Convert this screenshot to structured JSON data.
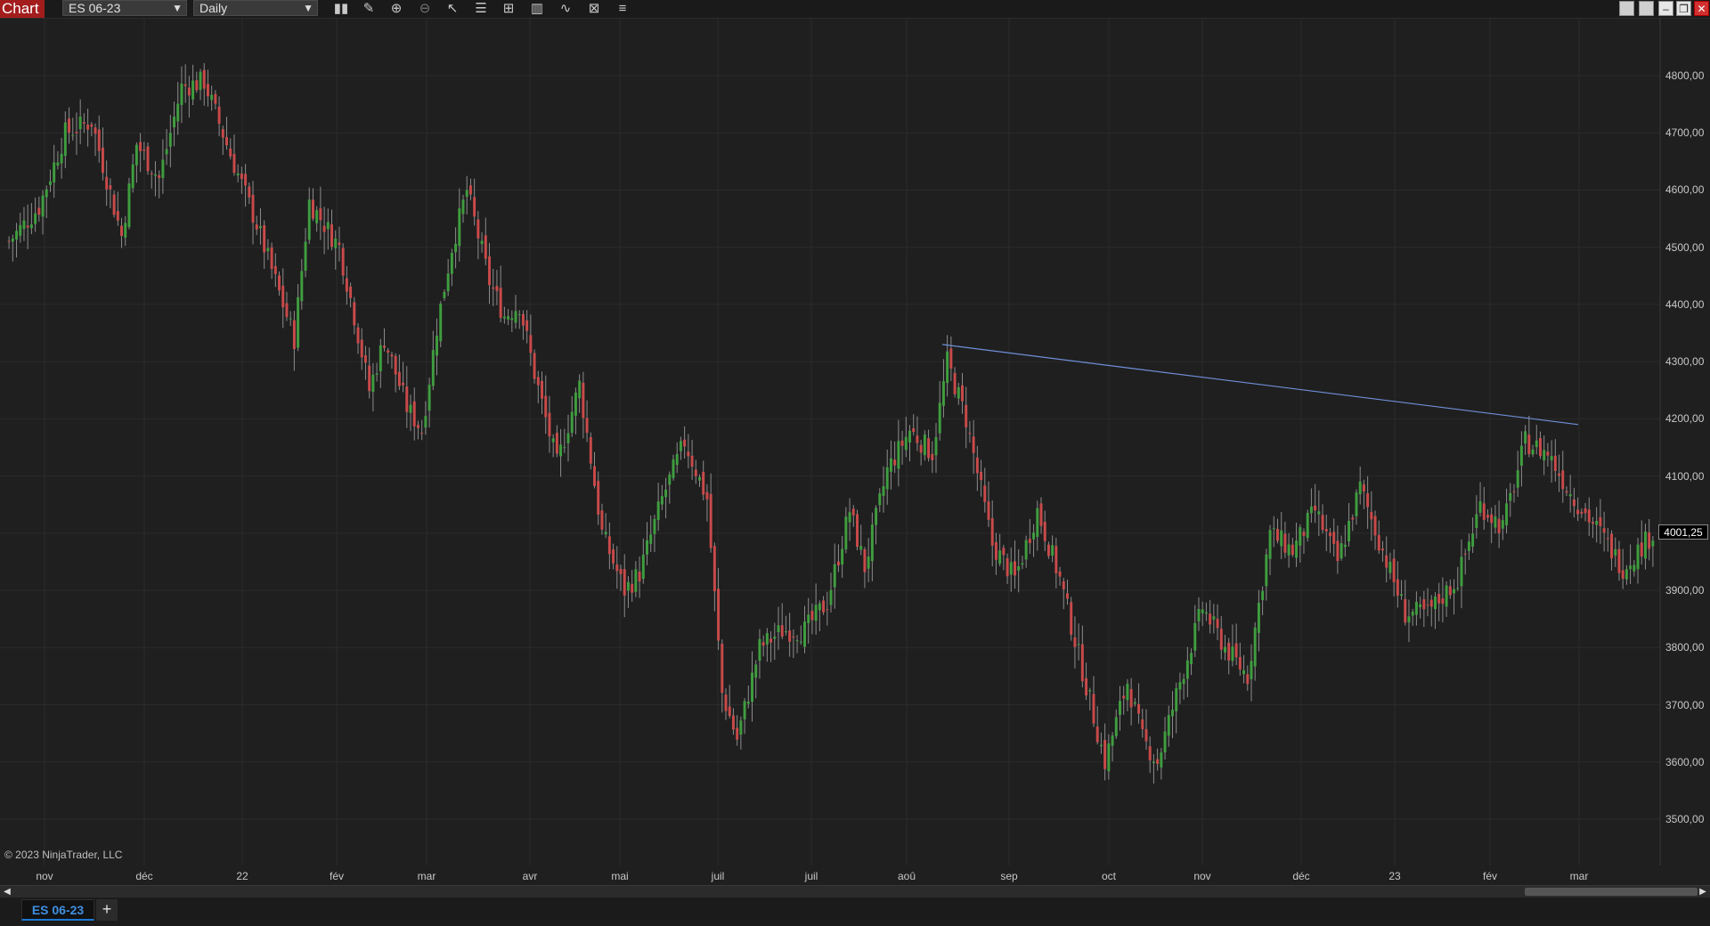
{
  "toolbar": {
    "badge": "Chart",
    "instrument": "ES 06-23",
    "interval": "Daily",
    "icons": [
      "bar-type-icon",
      "draw-pen-icon",
      "zoom-in-icon",
      "zoom-out-icon",
      "pointer-icon",
      "data-box-icon",
      "strategy-icon",
      "chart-style-icon",
      "indicators-icon",
      "properties-icon",
      "object-list-icon"
    ]
  },
  "window_buttons": [
    "tile-icon",
    "tile-icon",
    "minimize-icon",
    "restore-icon",
    "close-icon"
  ],
  "copyright": "© 2023 NinjaTrader, LLC",
  "current_price_label": "4001,25",
  "tabs": {
    "active": "ES 06-23",
    "add": "+"
  },
  "chart_data": {
    "type": "candlestick",
    "instrument": "ES 06-23",
    "interval": "Daily",
    "y_axis_labels": [
      "4800,00",
      "4700,00",
      "4600,00",
      "4500,00",
      "4400,00",
      "4300,00",
      "4200,00",
      "4100,00",
      "4000,00",
      "3900,00",
      "3800,00",
      "3700,00",
      "3600,00",
      "3500,00"
    ],
    "y_axis_values": [
      4800,
      4700,
      4600,
      4500,
      4400,
      4300,
      4200,
      4100,
      4000,
      3900,
      3800,
      3700,
      3600,
      3500
    ],
    "ylim": [
      3440,
      4880
    ],
    "x_axis_labels": [
      "nov",
      "déc",
      "22",
      "fév",
      "mar",
      "avr",
      "mai",
      "juil",
      "juil",
      "aoû",
      "sep",
      "oct",
      "nov",
      "déc",
      "23",
      "fév",
      "mar"
    ],
    "last_price": 4001.25,
    "colors": {
      "up": "#3f9d3f",
      "down": "#c94a4a",
      "wick": "#8c8c8c",
      "trendline": "#6f8fd8",
      "grid": "#2b2b2b",
      "background": "#1f1f1f"
    },
    "trend_line": {
      "from": 4330,
      "to": 4190
    },
    "anchors": [
      [
        0,
        4510
      ],
      [
        8,
        4570
      ],
      [
        15,
        4700
      ],
      [
        22,
        4720
      ],
      [
        26,
        4620
      ],
      [
        30,
        4520
      ],
      [
        34,
        4680
      ],
      [
        40,
        4620
      ],
      [
        46,
        4780
      ],
      [
        52,
        4790
      ],
      [
        58,
        4680
      ],
      [
        66,
        4540
      ],
      [
        72,
        4420
      ],
      [
        76,
        4340
      ],
      [
        80,
        4580
      ],
      [
        88,
        4500
      ],
      [
        92,
        4380
      ],
      [
        96,
        4250
      ],
      [
        100,
        4340
      ],
      [
        106,
        4220
      ],
      [
        110,
        4180
      ],
      [
        114,
        4360
      ],
      [
        118,
        4500
      ],
      [
        122,
        4600
      ],
      [
        128,
        4440
      ],
      [
        132,
        4380
      ],
      [
        136,
        4400
      ],
      [
        140,
        4280
      ],
      [
        146,
        4120
      ],
      [
        152,
        4260
      ],
      [
        158,
        4000
      ],
      [
        164,
        3900
      ],
      [
        168,
        3930
      ],
      [
        174,
        4060
      ],
      [
        180,
        4160
      ],
      [
        186,
        4060
      ],
      [
        190,
        3720
      ],
      [
        194,
        3640
      ],
      [
        200,
        3800
      ],
      [
        206,
        3830
      ],
      [
        212,
        3830
      ],
      [
        218,
        3880
      ],
      [
        224,
        4040
      ],
      [
        228,
        3940
      ],
      [
        234,
        4110
      ],
      [
        240,
        4180
      ],
      [
        246,
        4140
      ],
      [
        250,
        4300
      ],
      [
        255,
        4200
      ],
      [
        262,
        3980
      ],
      [
        268,
        3920
      ],
      [
        274,
        4040
      ],
      [
        280,
        3920
      ],
      [
        286,
        3760
      ],
      [
        292,
        3600
      ],
      [
        298,
        3740
      ],
      [
        302,
        3640
      ],
      [
        306,
        3600
      ],
      [
        312,
        3740
      ],
      [
        318,
        3870
      ],
      [
        324,
        3800
      ],
      [
        330,
        3750
      ],
      [
        336,
        4000
      ],
      [
        342,
        3970
      ],
      [
        348,
        4040
      ],
      [
        354,
        3950
      ],
      [
        360,
        4080
      ],
      [
        366,
        3970
      ],
      [
        372,
        3860
      ],
      [
        378,
        3860
      ],
      [
        386,
        3920
      ],
      [
        392,
        4050
      ],
      [
        398,
        4010
      ],
      [
        404,
        4160
      ],
      [
        410,
        4140
      ],
      [
        416,
        4070
      ],
      [
        424,
        4000
      ],
      [
        430,
        3940
      ],
      [
        438,
        4000
      ]
    ]
  }
}
